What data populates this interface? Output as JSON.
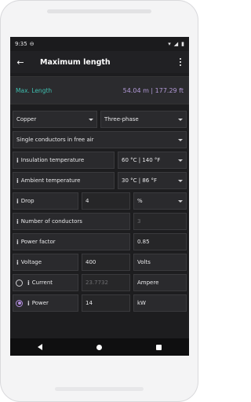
{
  "status": {
    "time": "9:35"
  },
  "app": {
    "title": "Maximum length"
  },
  "result": {
    "label": "Max. Length",
    "value": "54.04 m | 177.29 ft"
  },
  "selects": {
    "conductor": "Copper",
    "phase": "Three-phase",
    "installation": "Single conductors in free air"
  },
  "fields": {
    "insulation_temp_label": "Insulation temperature",
    "insulation_temp_value": "60 °C | 140 °F",
    "ambient_temp_label": "Ambient temperature",
    "ambient_temp_value": "30 °C | 86 °F",
    "drop_label": "Drop",
    "drop_value": "4",
    "drop_unit": "%",
    "conductors_label": "Number of conductors",
    "conductors_value": "3",
    "power_factor_label": "Power factor",
    "power_factor_value": "0.85",
    "voltage_label": "Voltage",
    "voltage_value": "400",
    "voltage_unit": "Volts",
    "current_label": "Current",
    "current_value": "23.7732",
    "current_unit": "Ampere",
    "power_label": "Power",
    "power_value": "14",
    "power_unit": "kW"
  },
  "colors": {
    "accent": "#b38ee0",
    "label_teal": "#3fbfb0"
  }
}
